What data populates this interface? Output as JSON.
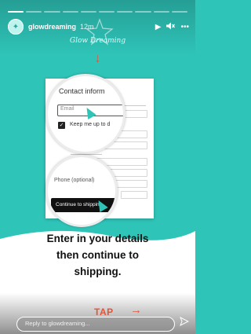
{
  "colors": {
    "background": "#2fc4b8",
    "accent": "#e2553a",
    "button": "#111111"
  },
  "progress": {
    "segments": 10,
    "completed": 1
  },
  "header": {
    "username": "glowdreaming",
    "time": "12m",
    "icons": [
      "play-icon",
      "volume-icon",
      "more-options-icon"
    ]
  },
  "brand": {
    "name": "Glow Dreaming"
  },
  "story": {
    "zoom_title": "Contact inform",
    "email_placeholder": "Email",
    "keep_label": "Keep me up to d",
    "phone_label": "Phone (optional)",
    "continue_button": "Continue to shipping",
    "instruction_lines": [
      "Enter in your details",
      "then continue to",
      "shipping."
    ],
    "tap_label": "TAP"
  },
  "reply": {
    "placeholder": "Reply to glowdreaming..."
  }
}
